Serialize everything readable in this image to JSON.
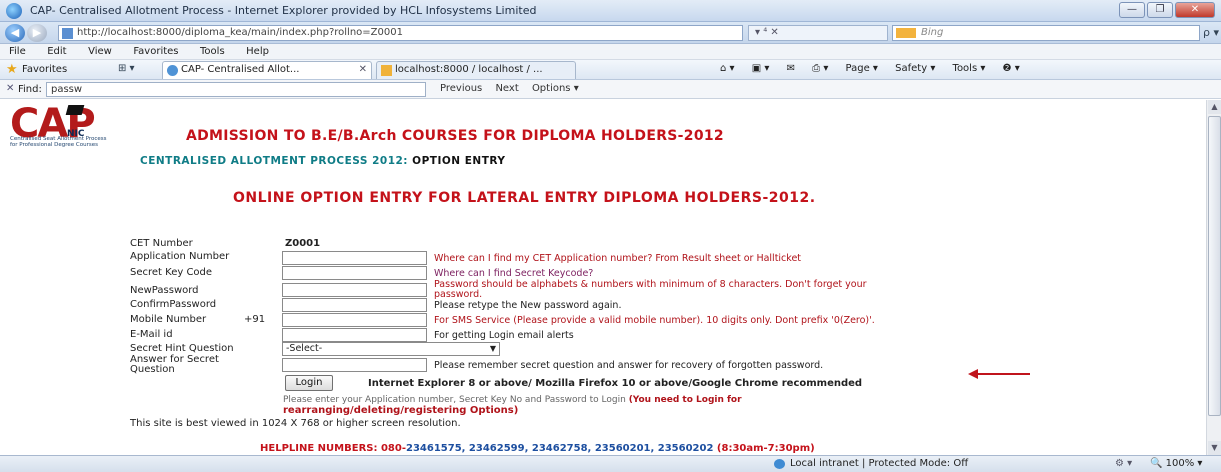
{
  "window": {
    "title": "CAP- Centralised Allotment Process - Internet Explorer provided by HCL Infosystems Limited",
    "buttons": [
      "—",
      "❐",
      "✕"
    ]
  },
  "address": {
    "url": "http://localhost:8000/diploma_kea/main/index.php?rollno=Z0001",
    "tools": "▾ ⁴ ✕",
    "search_placeholder": "Bing",
    "search_go": "ρ ▾"
  },
  "menu": [
    "File",
    "Edit",
    "View",
    "Favorites",
    "Tools",
    "Help"
  ],
  "favorites": {
    "label": "Favorites",
    "tab_icons": "⊞ ▾",
    "tabs": [
      {
        "label": "CAP- Centralised Allot...",
        "close": "✕"
      },
      {
        "label": "localhost:8000 / localhost / ...",
        "close": ""
      }
    ],
    "commands": [
      "Page ▾",
      "Safety ▾",
      "Tools ▾",
      "❷ ▾"
    ]
  },
  "find": {
    "close": "✕",
    "label": "Find:",
    "query": "passw",
    "previous": "Previous",
    "next": "Next",
    "options": "Options ▾"
  },
  "page": {
    "logo": {
      "text": "CAP",
      "nic": "NIC",
      "subtitle_1": "Centralised Seat Allotment Process",
      "subtitle_2": "for Professional Degree Courses"
    },
    "heading_main": "ADMISSION TO B.E/B.Arch COURSES FOR DIPLOMA HOLDERS-2012",
    "heading_sub_a": "CENTRALISED ALLOTMENT PROCESS 2012:",
    "heading_sub_b": " OPTION ENTRY",
    "heading_online": "ONLINE OPTION ENTRY FOR LATERAL ENTRY DIPLOMA HOLDERS-2012.",
    "form": {
      "cet_label": "CET Number",
      "cet_value": "Z0001",
      "application_label": "Application Number",
      "application_hint": "Where can I find my CET Application number? From Result sheet or Hallticket",
      "secret_key_label": "Secret Key Code",
      "secret_key_hint": "Where can I find Secret Keycode?",
      "new_password_label": "NewPassword",
      "new_password_hint_1": "Password should be alphabets & numbers with minimum of 8 characters. Don't forget your",
      "new_password_hint_2": "password.",
      "confirm_password_label": "ConfirmPassword",
      "confirm_password_hint": "Please retype the New password again.",
      "mobile_label": "Mobile Number",
      "mobile_prefix": "+91",
      "mobile_hint": "For SMS Service (Please provide a valid mobile number). 10 digits only. Dont prefix '0(Zero)'.",
      "email_label": "E-Mail id",
      "email_hint": "For getting Login email alerts",
      "secret_question_label": "Secret Hint Question",
      "secret_question_value": "-Select-",
      "secret_answer_label_1": "Answer for Secret",
      "secret_answer_label_2": "Question",
      "secret_answer_hint": "Please remember secret question and answer for recovery of forgotten password.",
      "login_button": "Login",
      "browser_recommendation": "Internet Explorer 8 or above/ Mozilla Firefox 10 or above/Google Chrome recommended",
      "login_note_a": "Please enter your Application number, Secret Key No and Password to Login",
      "login_note_b": "(You need to Login for",
      "login_note_c": "rearranging/deleting/registering Options)"
    },
    "best_viewed": "This site is best viewed in 1024 X 768 or higher screen resolution.",
    "helpline_label": "HELPLINE NUMBERS: 080-",
    "helpline_numbers": "23461575, 23462599, 23462758, 23560201, 23560202",
    "helpline_time": " (8:30am-7:30pm)"
  },
  "status": {
    "zone": "Local intranet | Protected Mode: Off",
    "security": "⚙ ▾",
    "zoom": "🔍 100% ▾"
  },
  "colors": {
    "heading_red": "#c4121a",
    "heading_teal": "#0f7c86",
    "hint_red": "#b0131a",
    "arrow_red": "#c0141c"
  }
}
